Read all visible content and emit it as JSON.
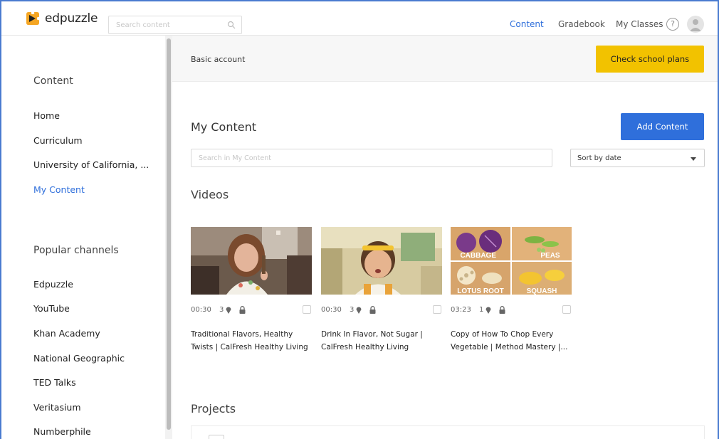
{
  "header": {
    "logo_text": "edpuzzle",
    "search_placeholder": "Search content",
    "nav": [
      {
        "label": "Content",
        "active": true
      },
      {
        "label": "Gradebook",
        "active": false
      },
      {
        "label": "My Classes",
        "active": false
      }
    ],
    "help_glyph": "?",
    "accent_color": "#2f6fdb"
  },
  "sidebar": {
    "content_heading": "Content",
    "content_items": [
      {
        "label": "Home",
        "active": false
      },
      {
        "label": "Curriculum",
        "active": false
      },
      {
        "label": "University of California, ...",
        "active": false
      },
      {
        "label": "My Content",
        "active": true
      }
    ],
    "channels_heading": "Popular channels",
    "channel_items": [
      {
        "label": "Edpuzzle"
      },
      {
        "label": "YouTube"
      },
      {
        "label": "Khan Academy"
      },
      {
        "label": "National Geographic"
      },
      {
        "label": "TED Talks"
      },
      {
        "label": "Veritasium"
      },
      {
        "label": "Numberphile"
      }
    ]
  },
  "banner": {
    "account_text": "Basic account",
    "plans_button": "Check school plans",
    "plans_color": "#f2c200"
  },
  "main": {
    "title": "My Content",
    "add_button": "Add Content",
    "search_placeholder": "Search in My Content",
    "sort_label": "Sort by date",
    "videos_heading": "Videos",
    "projects_heading": "Projects",
    "videos": [
      {
        "duration": "00:30",
        "questions": "3",
        "title": "Traditional Flavors, Healthy Twists | CalFresh Healthy Living",
        "thumb_icon": "girl-smiling-thumbnail"
      },
      {
        "duration": "00:30",
        "questions": "3",
        "title": "Drink In Flavor, Not Sugar | CalFresh Healthy Living",
        "thumb_icon": "boy-headband-thumbnail"
      },
      {
        "duration": "03:23",
        "questions": "1",
        "title": "Copy of How To Chop Every Vegetable | Method Mastery |...",
        "thumb_icon": "vegetables-grid-thumbnail",
        "thumb_labels": [
          "CABBAGE",
          "PEAS",
          "LOTUS ROOT",
          "SQUASH"
        ]
      }
    ]
  }
}
